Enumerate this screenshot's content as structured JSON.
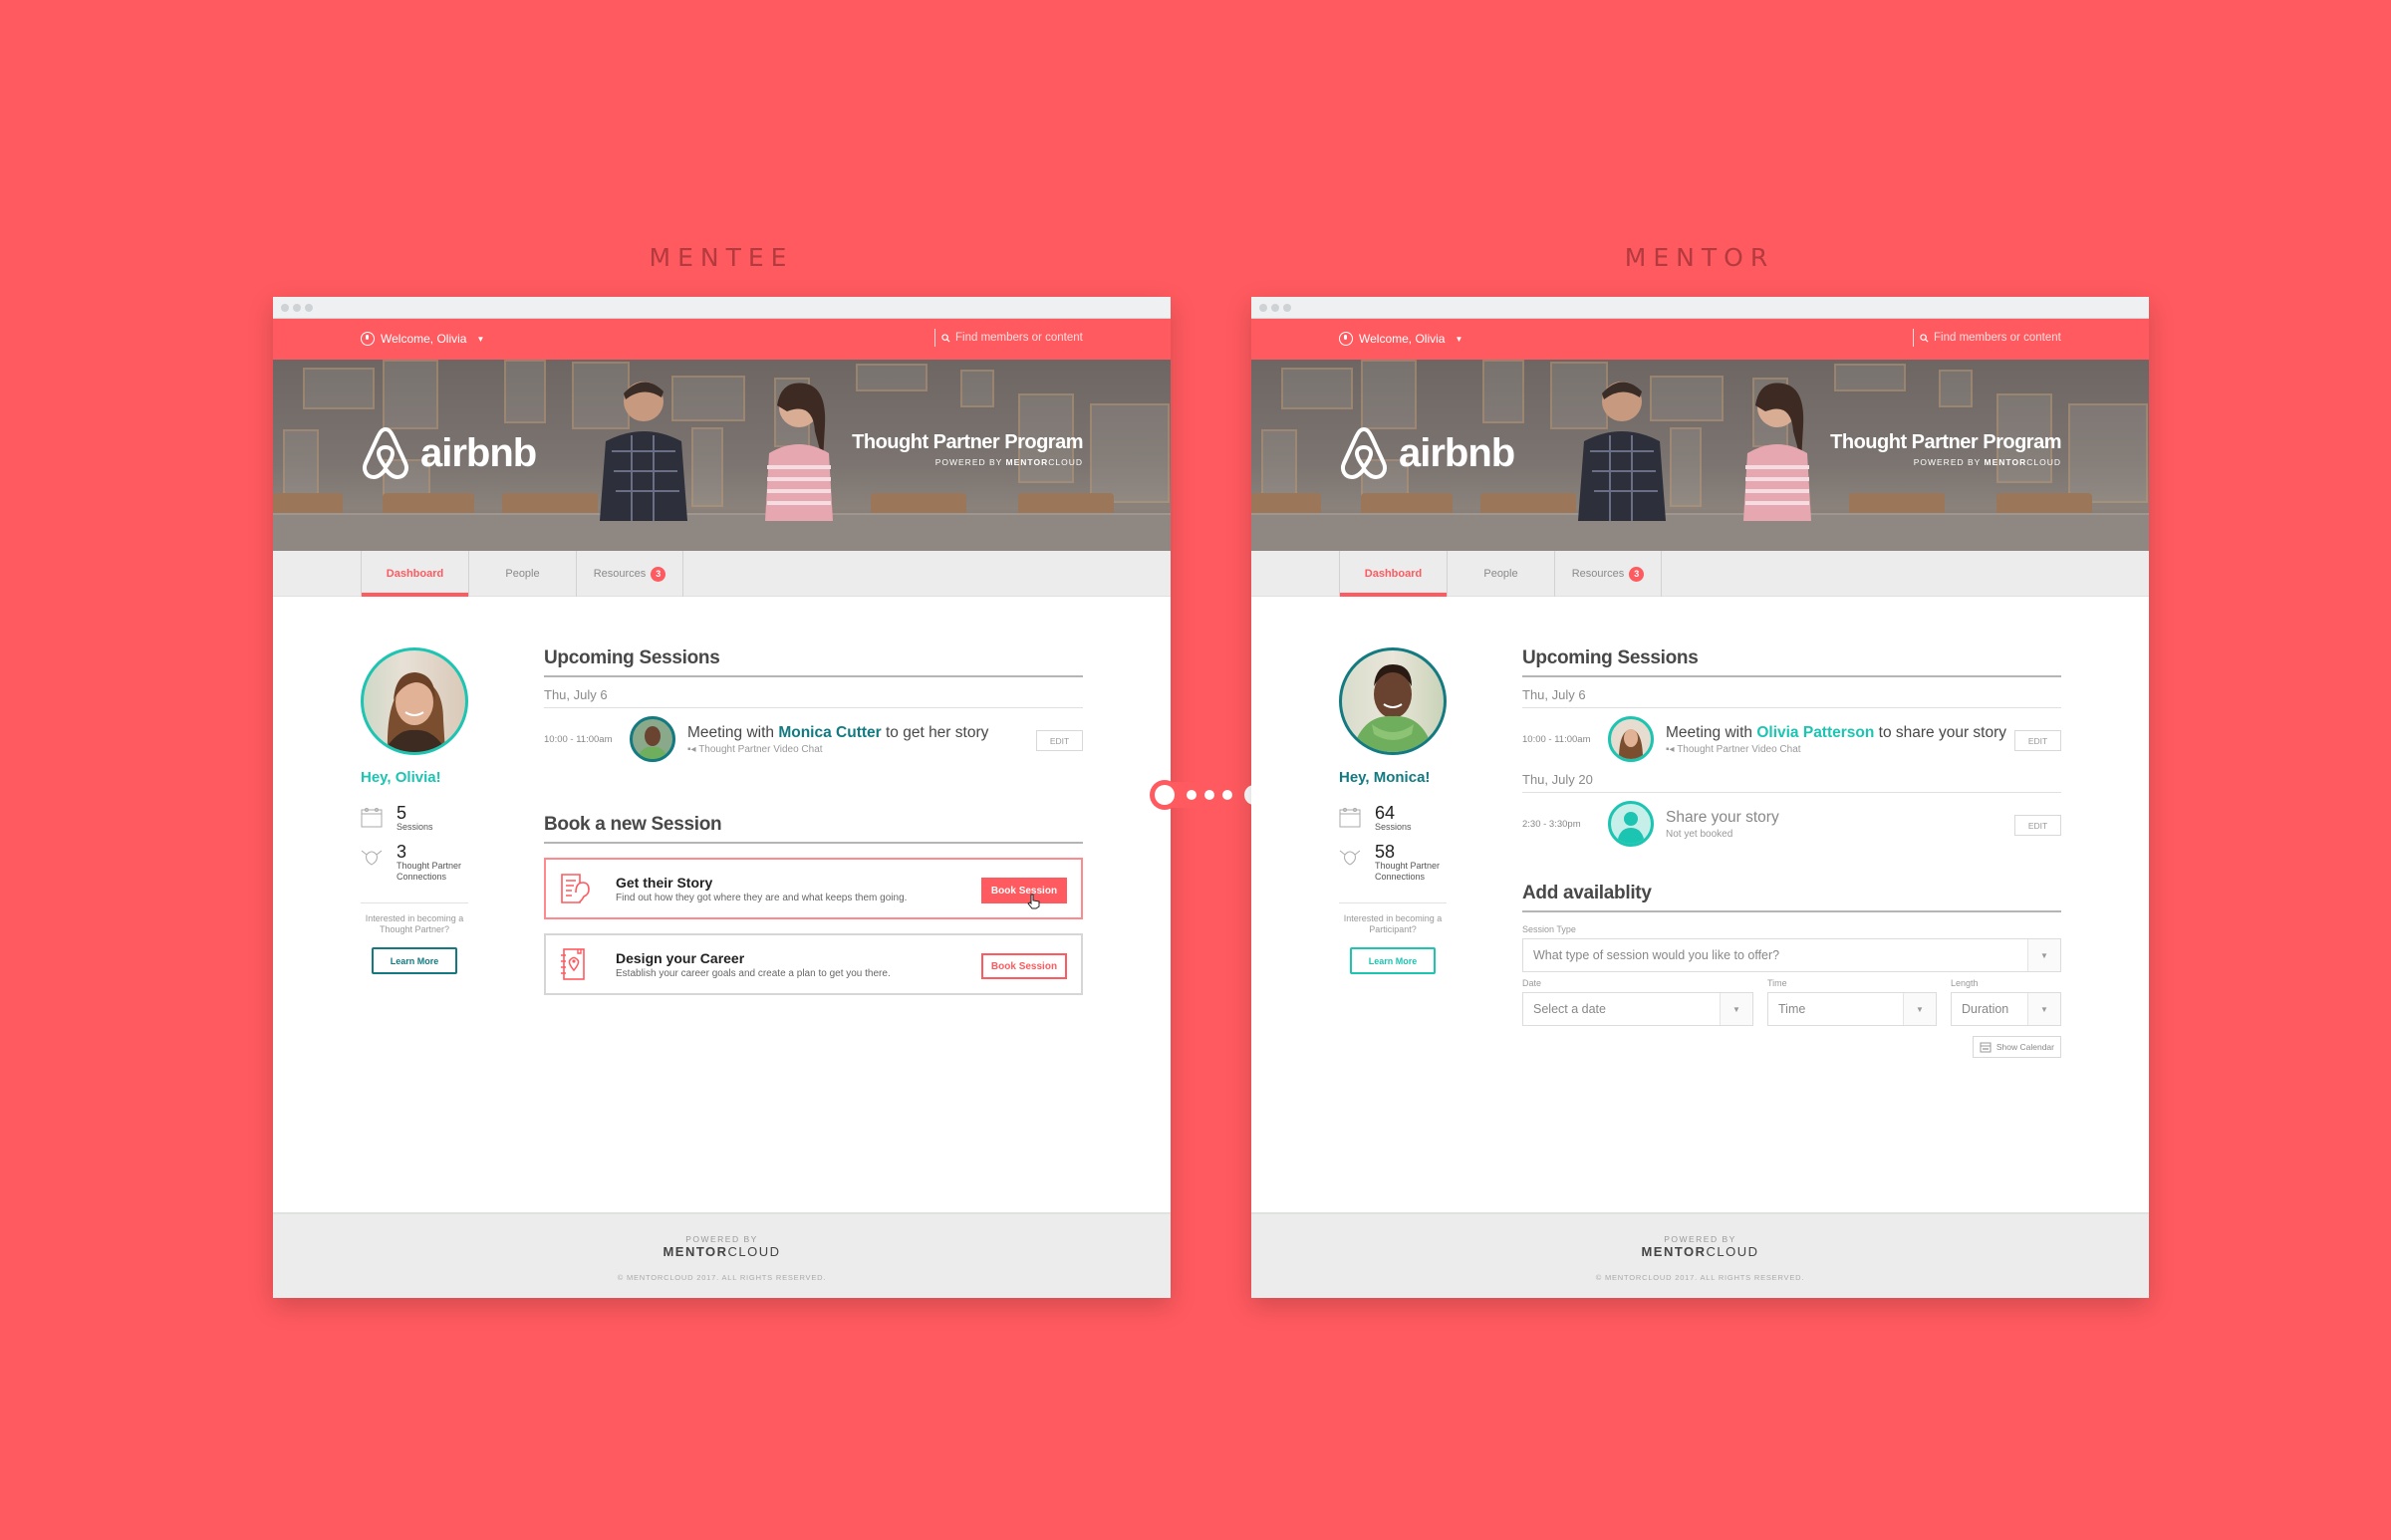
{
  "labels": {
    "mentee": "MENTEE",
    "mentor": "MENTOR"
  },
  "colors": {
    "brand": "#ff5a5f",
    "teal": "#1cc4b2",
    "dark_teal": "#127a80"
  },
  "mentee": {
    "topbar": {
      "welcome": "Welcome, Olivia",
      "search_placeholder": "Find members or content"
    },
    "hero": {
      "logo": "airbnb",
      "program_title": "Thought Partner Program",
      "powered_by": "POWERED BY",
      "mentor": "MENTOR",
      "cloud": "CLOUD"
    },
    "tabs": [
      {
        "label": "Dashboard",
        "active": true
      },
      {
        "label": "People"
      },
      {
        "label": "Resources",
        "badge": "3"
      }
    ],
    "sidebar": {
      "greeting": "Hey, Olivia!",
      "stats": [
        {
          "value": "5",
          "label": "Sessions"
        },
        {
          "value": "3",
          "label": "Thought Partner Connections"
        }
      ],
      "interest": "Interested in becoming a Thought Partner?",
      "learn_more": "Learn More"
    },
    "upcoming": {
      "title": "Upcoming Sessions",
      "days": [
        {
          "date": "Thu, July 6",
          "sessions": [
            {
              "time": "10:00 - 11:00am",
              "prefix": "Meeting with ",
              "name": "Monica Cutter",
              "suffix": " to get her story",
              "subtitle": "Thought Partner Video Chat",
              "edit": "EDIT"
            }
          ]
        }
      ]
    },
    "book": {
      "title": "Book a new Session",
      "cards": [
        {
          "title": "Get their Story",
          "desc": "Find out how they got where they are and what keeps them going.",
          "button": "Book Session",
          "icon": "ear-document-icon"
        },
        {
          "title": "Design your Career",
          "desc": "Establish your career goals and create a plan to get you there.",
          "button": "Book Session",
          "icon": "map-pin-notebook-icon"
        }
      ]
    },
    "footer": {
      "powered_by": "POWERED BY",
      "brand_bold": "MENTOR",
      "brand_light": "CLOUD",
      "copyright": "© MENTORCLOUD 2017. ALL RIGHTS RESERVED."
    }
  },
  "mentor": {
    "topbar": {
      "welcome": "Welcome, Olivia",
      "search_placeholder": "Find members or content"
    },
    "hero": {
      "logo": "airbnb",
      "program_title": "Thought Partner Program",
      "powered_by": "POWERED BY",
      "mentor": "MENTOR",
      "cloud": "CLOUD"
    },
    "tabs": [
      {
        "label": "Dashboard",
        "active": true
      },
      {
        "label": "People"
      },
      {
        "label": "Resources",
        "badge": "3"
      }
    ],
    "sidebar": {
      "greeting": "Hey, Monica!",
      "stats": [
        {
          "value": "64",
          "label": "Sessions"
        },
        {
          "value": "58",
          "label": "Thought Partner Connections"
        }
      ],
      "interest": "Interested in becoming a Participant?",
      "learn_more": "Learn More"
    },
    "upcoming": {
      "title": "Upcoming Sessions",
      "days": [
        {
          "date": "Thu, July 6",
          "sessions": [
            {
              "time": "10:00 - 11:00am",
              "prefix": "Meeting with ",
              "name": "Olivia Patterson",
              "suffix": " to share your story",
              "subtitle": "Thought Partner Video Chat",
              "edit": "EDIT"
            }
          ]
        },
        {
          "date": "Thu, July 20",
          "sessions": [
            {
              "time": "2:30 - 3:30pm",
              "title": "Share your story",
              "subtitle": "Not yet booked",
              "edit": "EDIT"
            }
          ]
        }
      ]
    },
    "availability": {
      "title": "Add availablity",
      "session_type_label": "Session Type",
      "session_type_placeholder": "What type of session would you like to offer?",
      "date_label": "Date",
      "date_placeholder": "Select a date",
      "time_label": "Time",
      "time_placeholder": "Time",
      "length_label": "Length",
      "length_placeholder": "Duration",
      "show_calendar": "Show Calendar"
    },
    "footer": {
      "powered_by": "POWERED BY",
      "brand_bold": "MENTOR",
      "brand_light": "CLOUD",
      "copyright": "© MENTORCLOUD 2017. ALL RIGHTS RESERVED."
    }
  }
}
